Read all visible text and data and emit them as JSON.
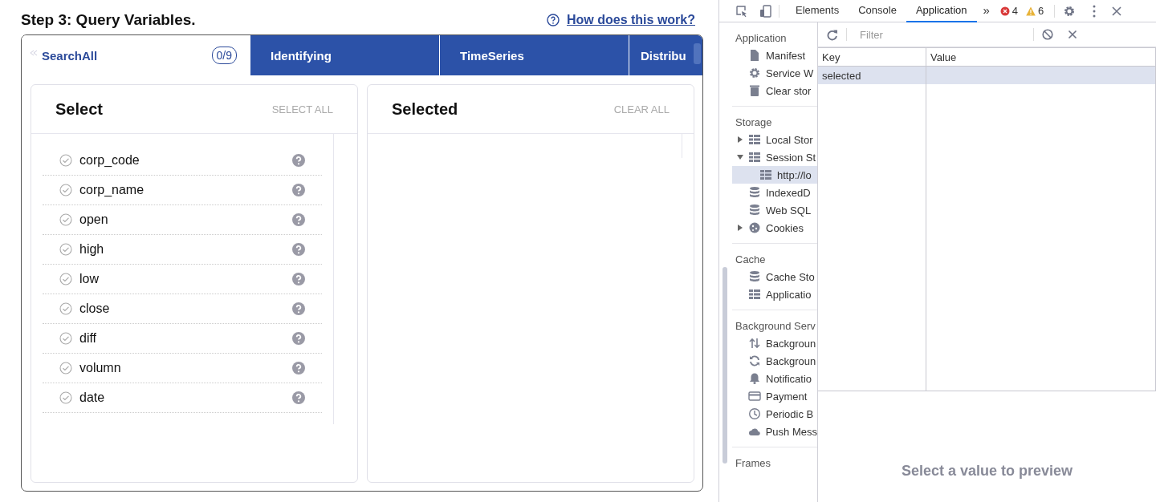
{
  "page": {
    "title": "Step 3: Query Variables.",
    "help_link": "How does this work?"
  },
  "tabs": [
    {
      "label": "SearchAll",
      "count": "0/9",
      "selected": true
    },
    {
      "label": "Identifying",
      "selected": false
    },
    {
      "label": "TimeSeries",
      "selected": false
    },
    {
      "label": "Distribu",
      "selected": false
    }
  ],
  "select_panel": {
    "title": "Select",
    "action": "SELECT ALL",
    "variables": [
      {
        "name": "corp_code",
        "checked": false
      },
      {
        "name": "corp_name",
        "checked": false
      },
      {
        "name": "open",
        "checked": false
      },
      {
        "name": "high",
        "checked": false
      },
      {
        "name": "low",
        "checked": false
      },
      {
        "name": "close",
        "checked": false
      },
      {
        "name": "diff",
        "checked": false
      },
      {
        "name": "volumn",
        "checked": false
      },
      {
        "name": "date",
        "checked": false
      }
    ]
  },
  "selected_panel": {
    "title": "Selected",
    "action": "CLEAR ALL"
  },
  "devtools": {
    "tabs": [
      {
        "label": "Elements",
        "selected": false
      },
      {
        "label": "Console",
        "selected": false
      },
      {
        "label": "Application",
        "selected": true
      }
    ],
    "more": "»",
    "errors": "4",
    "warnings": "6",
    "sidebar": [
      {
        "heading": "Application",
        "items": [
          {
            "label": "Manifest",
            "selected": false
          },
          {
            "label": "Service W",
            "selected": false
          },
          {
            "label": "Clear stor",
            "selected": false
          }
        ]
      },
      {
        "heading": "Storage",
        "items": [
          {
            "label": "Local Stor",
            "selected": false,
            "expanded": false
          },
          {
            "label": "Session St",
            "selected": false,
            "expanded": true,
            "children": [
              {
                "label": "http://lo",
                "selected": true
              }
            ]
          },
          {
            "label": "IndexedD",
            "selected": false
          },
          {
            "label": "Web SQL",
            "selected": false
          },
          {
            "label": "Cookies",
            "selected": false,
            "expanded": false
          }
        ]
      },
      {
        "heading": "Cache",
        "items": [
          {
            "label": "Cache Sto",
            "selected": false
          },
          {
            "label": "Applicatio",
            "selected": false
          }
        ]
      },
      {
        "heading": "Background Serv",
        "items": [
          {
            "label": "Backgroun",
            "selected": false
          },
          {
            "label": "Backgroun",
            "selected": false
          },
          {
            "label": "Notificatio",
            "selected": false
          },
          {
            "label": "Payment",
            "selected": false
          },
          {
            "label": "Periodic B",
            "selected": false
          },
          {
            "label": "Push Mess",
            "selected": false
          }
        ]
      },
      {
        "heading": "Frames"
      }
    ],
    "filter": {
      "placeholder": "Filter"
    },
    "table": {
      "columns": [
        "Key",
        "Value"
      ],
      "rows": [
        {
          "key": "selected",
          "selected": true
        }
      ]
    },
    "preview": "Select a value to preview"
  }
}
